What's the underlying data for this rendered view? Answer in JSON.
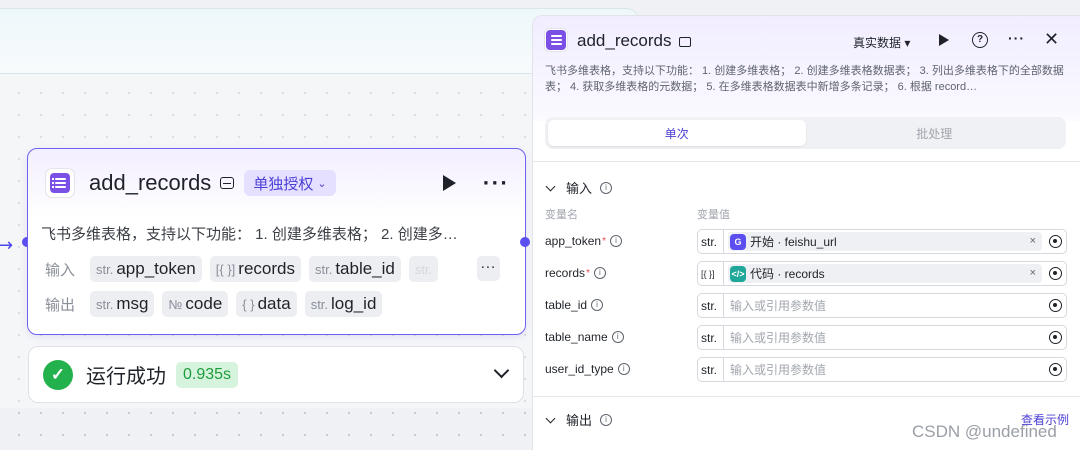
{
  "canvas": {
    "node": {
      "title": "add_records",
      "auth_chip": "单独授权",
      "description": "飞书多维表格，支持以下功能： 1. 创建多维表格； 2. 创建多…",
      "inputs_label": "输入",
      "outputs_label": "输出",
      "inputs": [
        {
          "type": "str.",
          "name": "app_token"
        },
        {
          "type": "[{ }]",
          "name": "records"
        },
        {
          "type": "str.",
          "name": "table_id"
        },
        {
          "type": "str.",
          "name": ""
        }
      ],
      "outputs": [
        {
          "type": "str.",
          "name": "msg"
        },
        {
          "type": "№",
          "name": "code"
        },
        {
          "type": "{ }",
          "name": "data"
        },
        {
          "type": "str.",
          "name": "log_id"
        }
      ],
      "more_label": "···"
    },
    "run_result": {
      "status": "运行成功",
      "duration": "0.935s"
    }
  },
  "panel": {
    "title": "add_records",
    "mode": "真实数据 ▾",
    "description": "飞书多维表格，支持以下功能： 1. 创建多维表格； 2. 创建多维表格数据表； 3. 列出多维表格下的全部数据表； 4. 获取多维表格的元数据； 5. 在多维表格数据表中新增多条记录； 6. 根据 record…",
    "tabs": [
      {
        "label": "单次",
        "active": true
      },
      {
        "label": "批处理",
        "active": false
      }
    ],
    "input_section": "输入",
    "col_name": "变量名",
    "col_value": "变量值",
    "params": [
      {
        "name": "app_token",
        "required": true,
        "type": "str.",
        "ref": "开始 · feishu_url",
        "ref_icon": "start-icon",
        "ref_color": "#5b4ff0",
        "placeholder": ""
      },
      {
        "name": "records",
        "required": true,
        "type": "[{ }]",
        "ref": "代码 · records",
        "ref_icon": "code-icon",
        "ref_color": "#1fa89a",
        "placeholder": ""
      },
      {
        "name": "table_id",
        "required": false,
        "type": "str.",
        "ref": "",
        "placeholder": "输入或引用参数值"
      },
      {
        "name": "table_name",
        "required": false,
        "type": "str.",
        "ref": "",
        "placeholder": "输入或引用参数值"
      },
      {
        "name": "user_id_type",
        "required": false,
        "type": "str.",
        "ref": "",
        "placeholder": "输入或引用参数值"
      }
    ],
    "output_section": "输出",
    "example_link": "查看示例"
  },
  "watermark": "CSDN @undefined",
  "colors": {
    "accent": "#5b4ff0",
    "success": "#22b14c",
    "app": "#7b50e6"
  }
}
